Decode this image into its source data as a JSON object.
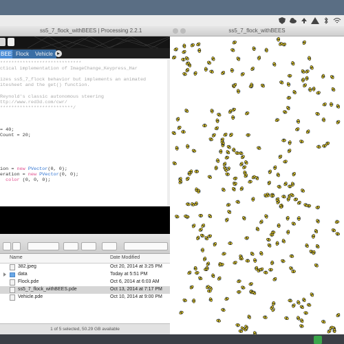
{
  "editor": {
    "title": "ss5_7_flock_withBEES | Processing 2.2.1",
    "tabs": [
      "BEES",
      "Flock",
      "Vehicle"
    ],
    "code_lines": [
      {
        "segments": [
          {
            "t": "*****************************",
            "c": "c"
          }
        ]
      },
      {
        "segments": [
          {
            "t": "ctical implementation of ImageChange_Keypress_Har",
            "c": "c"
          }
        ]
      },
      {
        "segments": [
          {
            "t": "",
            "c": "c"
          }
        ]
      },
      {
        "segments": [
          {
            "t": "izes ss5_7_flock behavior but implements an animated",
            "c": "c"
          }
        ]
      },
      {
        "segments": [
          {
            "t": "itesheet and the get() function.",
            "c": "c"
          }
        ]
      },
      {
        "segments": [
          {
            "t": "",
            "c": "c"
          }
        ]
      },
      {
        "segments": [
          {
            "t": "Reynold's classic autonomous steering",
            "c": "c"
          }
        ]
      },
      {
        "segments": [
          {
            "t": "ttp://www.red3d.com/cwr/",
            "c": "c"
          }
        ]
      },
      {
        "segments": [
          {
            "t": "**************************/",
            "c": "c"
          }
        ]
      },
      {
        "segments": [
          {
            "t": "",
            "c": "c"
          }
        ]
      },
      {
        "segments": [
          {
            "t": "",
            "c": "c"
          }
        ]
      },
      {
        "segments": [
          {
            "t": "",
            "c": "c"
          }
        ]
      },
      {
        "segments": [
          {
            "t": "= 40;",
            "c": "t"
          }
        ]
      },
      {
        "segments": [
          {
            "t": "Count = 20;",
            "c": "t"
          }
        ]
      },
      {
        "segments": [
          {
            "t": "",
            "c": "c"
          }
        ]
      },
      {
        "segments": [
          {
            "t": "",
            "c": "c"
          }
        ]
      },
      {
        "segments": [
          {
            "t": "",
            "c": "c"
          }
        ]
      },
      {
        "segments": [
          {
            "t": "",
            "c": "c"
          }
        ]
      },
      {
        "segments": [
          {
            "t": "",
            "c": "c"
          }
        ]
      },
      {
        "segments": [
          {
            "t": "ion = ",
            "c": "t"
          },
          {
            "t": "new",
            "c": "k"
          },
          {
            "t": " ",
            "c": "t"
          },
          {
            "t": "PVector",
            "c": "b"
          },
          {
            "t": "(0, 0);",
            "c": "t"
          }
        ]
      },
      {
        "segments": [
          {
            "t": "eration = ",
            "c": "t"
          },
          {
            "t": "new",
            "c": "k"
          },
          {
            "t": " ",
            "c": "t"
          },
          {
            "t": "PVector",
            "c": "b"
          },
          {
            "t": "(0, 0);",
            "c": "t"
          }
        ]
      },
      {
        "segments": [
          {
            "t": "  ",
            "c": "t"
          },
          {
            "t": "color",
            "c": "k"
          },
          {
            "t": " (0, 0, 0);",
            "c": "t"
          }
        ]
      }
    ]
  },
  "finder": {
    "path": "",
    "col_name": "Name",
    "col_date": "Date Modified",
    "files": [
      {
        "name": "382.jpeg",
        "date": "Oct 20, 2014 at 3:25 PM",
        "kind": "file",
        "selected": false,
        "expand": false
      },
      {
        "name": "data",
        "date": "Today at 5:51 PM",
        "kind": "folder",
        "selected": false,
        "expand": true
      },
      {
        "name": "Flock.pde",
        "date": "Oct 6, 2014 at 6:03 AM",
        "kind": "file",
        "selected": false,
        "expand": false
      },
      {
        "name": "ss5_7_flock_withBEES.pde",
        "date": "Oct 13, 2014 at 7:17 PM",
        "kind": "file",
        "selected": true,
        "expand": false
      },
      {
        "name": "Vehicle.pde",
        "date": "Oct 10, 2014 at 9:00 PM",
        "kind": "file",
        "selected": false,
        "expand": false
      }
    ],
    "status": "1 of 5 selected, 50.29 GB available"
  },
  "sketch": {
    "title": "ss5_7_flock_withBEES"
  },
  "colors": {
    "bee_body": "#d6c02a",
    "bee_stripe": "#1a1a1a",
    "bee_wing": "#b8c4cc",
    "code_comment": "#aaaaaa",
    "code_keyword": "#e04a8a",
    "code_type": "#2d72d2",
    "tab_active": "#4c8dd6"
  }
}
